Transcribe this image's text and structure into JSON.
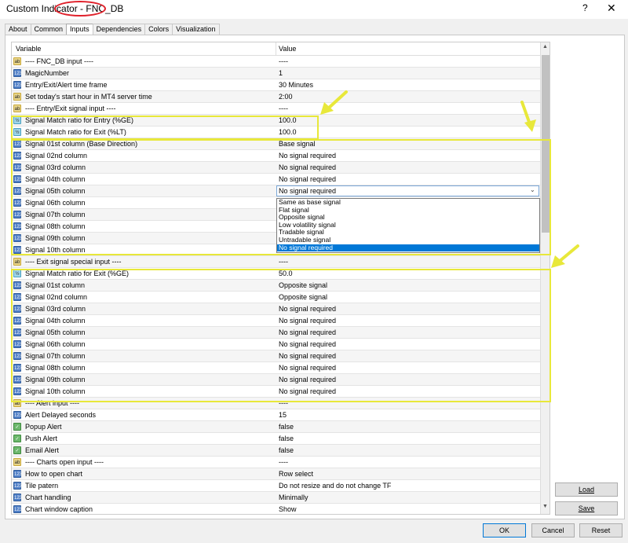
{
  "window": {
    "title": "Custom Indicator - FNC_DB",
    "help": "?",
    "close": "✕"
  },
  "tabs": [
    {
      "label": "About",
      "active": false
    },
    {
      "label": "Common",
      "active": false
    },
    {
      "label": "Inputs",
      "active": true
    },
    {
      "label": "Dependencies",
      "active": false
    },
    {
      "label": "Colors",
      "active": false
    },
    {
      "label": "Visualization",
      "active": false
    }
  ],
  "grid": {
    "col_variable": "Variable",
    "col_value": "Value",
    "rows": [
      {
        "icon": "ab",
        "variable": "---- FNC_DB input ----",
        "value": "----"
      },
      {
        "icon": "123",
        "variable": "MagicNumber",
        "value": "1"
      },
      {
        "icon": "123",
        "variable": "Entry/Exit/Alert time frame",
        "value": "30 Minutes"
      },
      {
        "icon": "ab",
        "variable": "Set today's start hour in MT4 server time",
        "value": "2:00"
      },
      {
        "icon": "ab",
        "variable": "---- Entry/Exit signal input ----",
        "value": "----"
      },
      {
        "icon": "½",
        "variable": "Signal Match ratio for Entry (%GE)",
        "value": "100.0"
      },
      {
        "icon": "½",
        "variable": "Signal Match ratio for Exit (%LT)",
        "value": "100.0"
      },
      {
        "icon": "123",
        "variable": "Signal 01st column (Base Direction)",
        "value": "Base signal"
      },
      {
        "icon": "123",
        "variable": "Signal 02nd column",
        "value": "No signal required"
      },
      {
        "icon": "123",
        "variable": "Signal 03rd column",
        "value": "No signal required"
      },
      {
        "icon": "123",
        "variable": "Signal 04th column",
        "value": "No signal required"
      },
      {
        "icon": "123",
        "variable": "Signal 05th column",
        "value": "No signal required"
      },
      {
        "icon": "123",
        "variable": "Signal 06th column",
        "value": ""
      },
      {
        "icon": "123",
        "variable": "Signal 07th column",
        "value": ""
      },
      {
        "icon": "123",
        "variable": "Signal 08th column",
        "value": ""
      },
      {
        "icon": "123",
        "variable": "Signal 09th column",
        "value": ""
      },
      {
        "icon": "123",
        "variable": "Signal 10th column",
        "value": ""
      },
      {
        "icon": "ab",
        "variable": "---- Exit signal special input ----",
        "value": "----"
      },
      {
        "icon": "½",
        "variable": "Signal Match ratio for Exit (%GE)",
        "value": "50.0"
      },
      {
        "icon": "123",
        "variable": "Signal 01st column",
        "value": "Opposite signal"
      },
      {
        "icon": "123",
        "variable": "Signal 02nd column",
        "value": "Opposite signal"
      },
      {
        "icon": "123",
        "variable": "Signal 03rd column",
        "value": "No signal required"
      },
      {
        "icon": "123",
        "variable": "Signal 04th column",
        "value": "No signal required"
      },
      {
        "icon": "123",
        "variable": "Signal 05th column",
        "value": "No signal required"
      },
      {
        "icon": "123",
        "variable": "Signal 06th column",
        "value": "No signal required"
      },
      {
        "icon": "123",
        "variable": "Signal 07th column",
        "value": "No signal required"
      },
      {
        "icon": "123",
        "variable": "Signal 08th column",
        "value": "No signal required"
      },
      {
        "icon": "123",
        "variable": "Signal 09th column",
        "value": "No signal required"
      },
      {
        "icon": "123",
        "variable": "Signal 10th column",
        "value": "No signal required"
      },
      {
        "icon": "ab",
        "variable": "---- Alert input ----",
        "value": "----"
      },
      {
        "icon": "123",
        "variable": "Alert Delayed seconds",
        "value": "15"
      },
      {
        "icon": "bool",
        "variable": "Popup Alert",
        "value": "false"
      },
      {
        "icon": "bool",
        "variable": "Push Alert",
        "value": "false"
      },
      {
        "icon": "bool",
        "variable": "Email Alert",
        "value": "false"
      },
      {
        "icon": "ab",
        "variable": "---- Charts open input ----",
        "value": "----"
      },
      {
        "icon": "123",
        "variable": "How to open chart",
        "value": "Row select"
      },
      {
        "icon": "123",
        "variable": "Tile patern",
        "value": "Do not resize and do not change TF"
      },
      {
        "icon": "123",
        "variable": "Chart handling",
        "value": "Minimally"
      },
      {
        "icon": "123",
        "variable": "Chart window caption",
        "value": "Show"
      }
    ]
  },
  "dropdown": {
    "options": [
      "Same as base signal",
      "Flat signal",
      "Opposite signal",
      "Low volatility signal",
      "Tradable signal",
      "Untradable signal",
      "No signal required"
    ],
    "selected": "No signal required"
  },
  "buttons": {
    "load": "Load",
    "save": "Save",
    "ok": "OK",
    "cancel": "Cancel",
    "reset": "Reset"
  },
  "colors": {
    "highlight_box": "#e8e83a",
    "title_oval": "#e0202a",
    "selection": "#0078d7"
  }
}
